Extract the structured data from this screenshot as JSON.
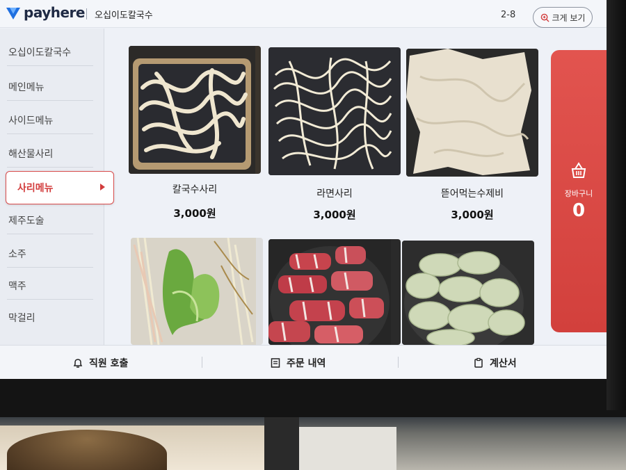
{
  "header": {
    "brand": "payhere",
    "store_name": "오십이도칼국수",
    "table_number": "2-8",
    "zoom_label": "크게 보기"
  },
  "sidebar": {
    "items": [
      {
        "label": "오십이도칼국수"
      },
      {
        "label": "메인메뉴"
      },
      {
        "label": "사이드메뉴"
      },
      {
        "label": "해산물사리"
      },
      {
        "label": "사리메뉴"
      },
      {
        "label": "제주도술"
      },
      {
        "label": "소주"
      },
      {
        "label": "맥주"
      },
      {
        "label": "막걸리"
      }
    ],
    "active": "사리메뉴"
  },
  "menu": {
    "items": [
      {
        "name": "칼국수사리",
        "price": "3,000원"
      },
      {
        "name": "라면사리",
        "price": "3,000원"
      },
      {
        "name": "뜯어먹는수제비",
        "price": "3,000원"
      },
      {
        "name": "",
        "price": ""
      },
      {
        "name": "",
        "price": ""
      },
      {
        "name": "",
        "price": ""
      }
    ]
  },
  "cart": {
    "label": "장바구니",
    "count": "0"
  },
  "footer": {
    "call_staff": "직원 호출",
    "order_history": "주문 내역",
    "bill": "계산서"
  },
  "colors": {
    "accent": "#d23b3b",
    "brand": "#1f6fe0"
  }
}
